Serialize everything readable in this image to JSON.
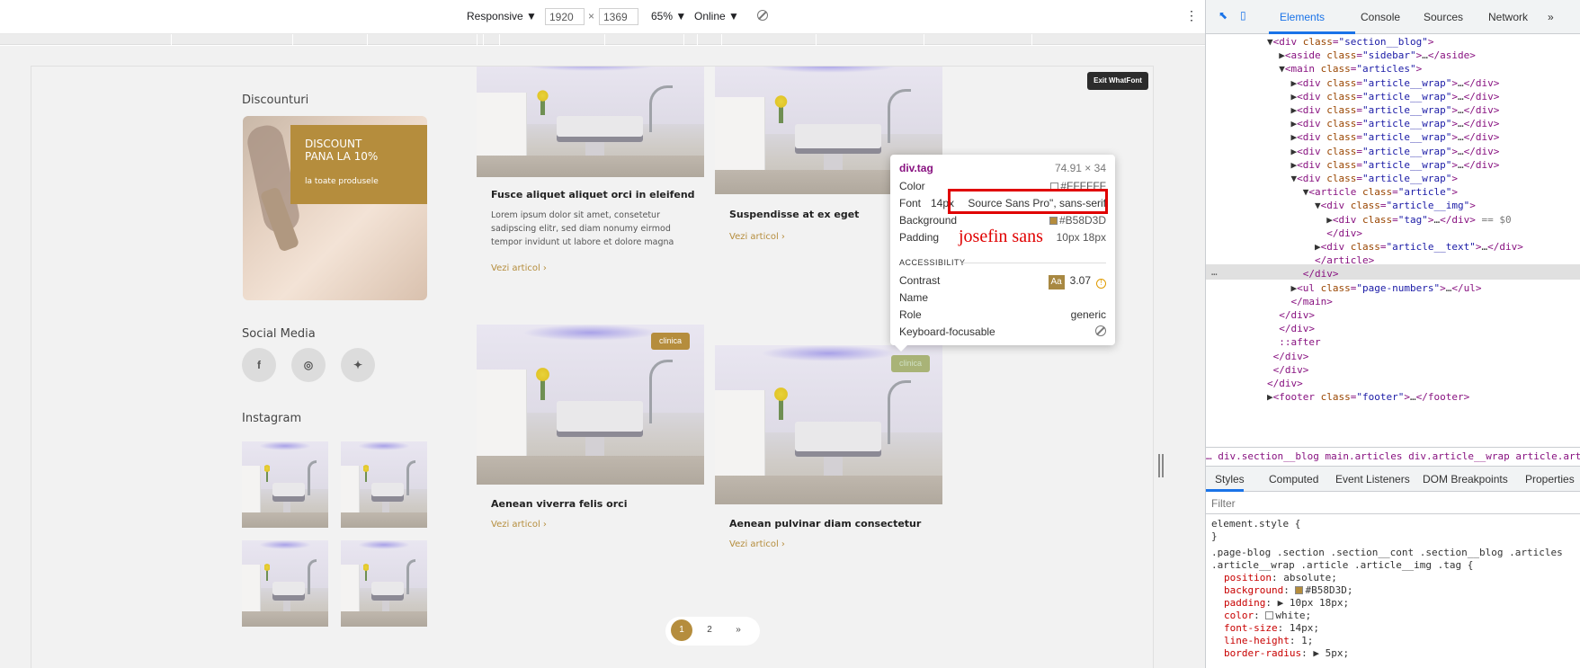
{
  "device_toolbar": {
    "mode": "Responsive ▼",
    "width": "1920",
    "times": "×",
    "height": "1369",
    "zoom": "65% ▼",
    "network": "Online ▼",
    "more": "⋮"
  },
  "page": {
    "exit_button": "Exit WhatFont",
    "sidebar": {
      "discounts_heading": "Discounturi",
      "promo_title": "DISCOUNT\nPANA LA 10%",
      "promo_subtitle": "la toate produsele",
      "social_heading": "Social Media",
      "social_icons": [
        "facebook-icon",
        "instagram-icon",
        "twitter-icon"
      ],
      "social_glyphs": [
        "f",
        "◎",
        "✦"
      ],
      "instagram_heading": "Instagram"
    },
    "articles": [
      {
        "title": "Fusce aliquet aliquet orci in eleifend",
        "excerpt": "Lorem ipsum dolor sit amet, consetetur\nsadipscing elitr, sed diam nonumy eirmod\ntempor invidunt ut labore et dolore magna",
        "read_more": "Vezi articol  ›"
      },
      {
        "title": "Suspendisse at ex eget",
        "read_more": "Vezi articol  ›"
      },
      {
        "title": "Aenean viverra felis orci",
        "tag": "clinica",
        "read_more": "Vezi articol  ›"
      },
      {
        "title": "Aenean pulvinar diam consectetur",
        "tag": "clinica",
        "read_more": "Vezi articol  ›"
      }
    ],
    "pagination": [
      "1",
      "2",
      "»"
    ]
  },
  "whatfont_tooltip": {
    "element": "div.tag",
    "size": "74.91 × 34",
    "rows": [
      {
        "label": "Color",
        "value": "#FFFFFF"
      },
      {
        "label": "Font",
        "size": "14px",
        "value": "Source Sans Pro\", sans-serif"
      },
      {
        "label": "Background",
        "value": "#B58D3D"
      },
      {
        "label": "Padding",
        "value": "10px 18px"
      }
    ],
    "accessibility_heading": "ACCESSIBILITY",
    "contrast_label": "Contrast",
    "contrast_badge": "Aa",
    "contrast_value": "3.07",
    "name_label": "Name",
    "role_label": "Role",
    "role_value": "generic",
    "keyboard_label": "Keyboard-focusable",
    "annotation": "josefin sans"
  },
  "devtools": {
    "tabs": [
      "Elements",
      "Console",
      "Sources",
      "Network",
      "»"
    ],
    "active_tab": "Elements",
    "dom_lines": [
      "▼<div class=\"section__blog\">",
      "  ▶<aside class=\"sidebar\">…</aside>",
      "  ▼<main class=\"articles\">",
      "    ▶<div class=\"article__wrap\">…</div>",
      "    ▶<div class=\"article__wrap\">…</div>",
      "    ▶<div class=\"article__wrap\">…</div>",
      "    ▶<div class=\"article__wrap\">…</div>",
      "    ▶<div class=\"article__wrap\">…</div>",
      "    ▶<div class=\"article__wrap\">…</div>",
      "    ▶<div class=\"article__wrap\">…</div>",
      "    ▼<div class=\"article__wrap\">",
      "      ▼<article class=\"article\">",
      "        ▼<div class=\"article__img\">",
      "          ▶<div class=\"tag\">…</div> == $0",
      "          </div>",
      "        ▶<div class=\"article__text\">…</div>",
      "        </article>",
      "      </div>",
      "    ▶<ul class=\"page-numbers\">…</ul>",
      "    </main>",
      "  </div>",
      "  </div>",
      "  ::after",
      " </div>",
      " </div>",
      "</div>",
      "▶<footer class=\"footer\">…</footer>"
    ],
    "gutter_dots": "…",
    "breadcrumbs": "…  div.section__blog   main.articles   div.article__wrap   article.article   div.a",
    "style_tabs": [
      "Styles",
      "Computed",
      "Event Listeners",
      "DOM Breakpoints",
      "Properties"
    ],
    "filter_placeholder": "Filter",
    "element_style": "element.style {",
    "element_style_close": "}",
    "selector": ".page-blog .section .section__cont .section__blog .articles\n.article__wrap .article .article__img .tag {",
    "declarations": [
      {
        "prop": "position",
        "value": "absolute;"
      },
      {
        "prop": "background",
        "value": "#B58D3D;",
        "swatch": "#B58D3D"
      },
      {
        "prop": "padding",
        "value": "▶ 10px 18px;"
      },
      {
        "prop": "color",
        "value": "white;",
        "swatch": "#FFFFFF"
      },
      {
        "prop": "font-size",
        "value": "14px;"
      },
      {
        "prop": "line-height",
        "value": "1;"
      },
      {
        "prop": "border-radius",
        "value": "▶ 5px;"
      }
    ]
  },
  "colors": {
    "accent_gold": "#B58D3D",
    "tag_white": "#FFFFFF",
    "annotation_red": "#E00000",
    "devtools_blue": "#1A73E8"
  }
}
